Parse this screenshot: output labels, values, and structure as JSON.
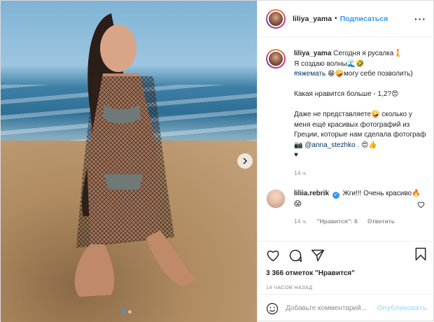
{
  "post": {
    "username": "liliya_yama",
    "follow_label": "Подписаться",
    "separator": "•",
    "more_label": "···"
  },
  "caption": {
    "username": "liliya_yama",
    "line1": "Сегодня я русалка🧜",
    "line2": "Я создаю волны🌊🤣",
    "hashtag": "#яжемать",
    "line3": " 😁🤪могу себе позволить)",
    "line4": "Какая нравится больше - 1,2?😍",
    "line5": "Даже не представляете🤪 сколько у меня ещё красивых фотографий из Греции, которые нам сделала фотограф 📷",
    "mention": "@anna_stezhko",
    "line6": ". 😍👍",
    "line7": "♥",
    "age": "14 ч."
  },
  "comment": {
    "username": "liliia.rebrik",
    "verified_mark": "✓",
    "text": "Жги!!! Очень красиво🔥😱",
    "age": "14 ч.",
    "likes_label": "\"Нравится\": 6",
    "reply_label": "Ответить"
  },
  "actions": {
    "likes_text": "3 366 отметок \"Нравится\"",
    "timestamp": "14 часов назад"
  },
  "add_comment": {
    "placeholder": "Добавьте комментарий...",
    "publish_label": "Опубликовать"
  },
  "carousel": {
    "total": 2,
    "current": 1,
    "next_icon": "chevron-right-icon"
  },
  "colors": {
    "accent": "#3897f0",
    "text": "#262626",
    "muted": "#8e8e8e"
  }
}
